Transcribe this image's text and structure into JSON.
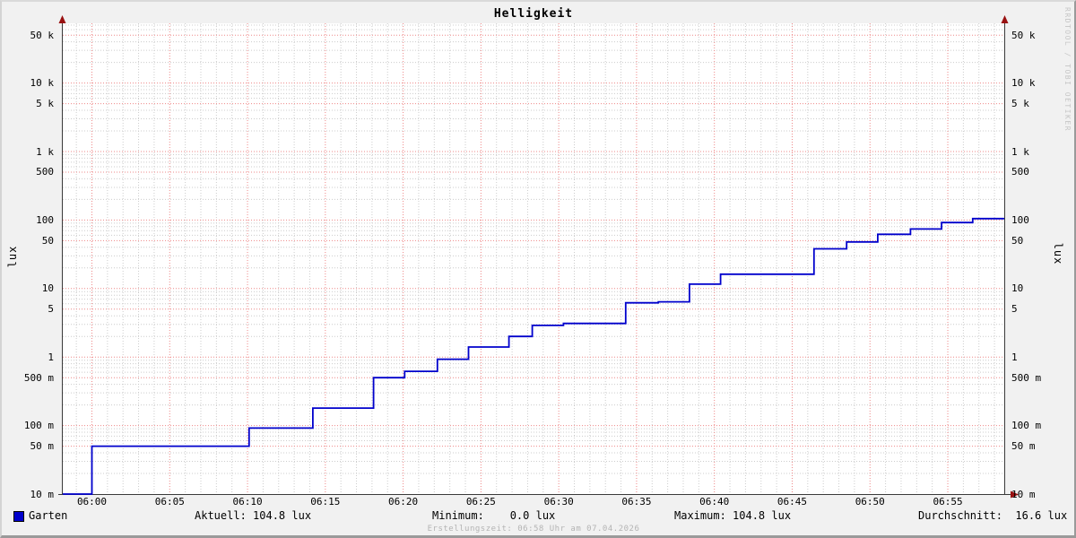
{
  "title": "Helligkeit",
  "watermark": "RRDTOOL / TOBI OETIKER",
  "y_axis_unit_left": "lux",
  "y_axis_unit_right": "lux",
  "footer": {
    "legend_label": "Garten",
    "aktuell": "Aktuell: 104.8 lux",
    "minimum": "Minimum:    0.0 lux",
    "maximum": "Maximum: 104.8 lux",
    "durchschnitt": "Durchschnitt:  16.6 lux",
    "erstellungszeit": "Erstellungszeit: 06:58 Uhr am 07.04.2026"
  },
  "colors": {
    "background": "#f1f1f1",
    "canvas": "#ffffff",
    "series_line": "#0000cc",
    "legend_swatch": "#0000cc",
    "major_grid": "#ee8888",
    "minor_grid": "#cccccc",
    "axis": "#3a3a3a",
    "arrow": "#991111",
    "watermark_text": "#c6c6c6",
    "creation_text": "#b4b4b4"
  },
  "chart_data": {
    "type": "line",
    "line_style": "step-after",
    "title": "Helligkeit",
    "xlabel": "",
    "ylabel": "lux",
    "y_scale": "log",
    "ylim": [
      0.01,
      75000
    ],
    "x_unit": "minutes after 06:00",
    "x_range_min": [
      -1.87,
      58.63
    ],
    "x_major_step_min": 5,
    "x_minor_step_min": 1,
    "x_ticks": [
      {
        "minute": 0,
        "label": "06:00"
      },
      {
        "minute": 5,
        "label": "06:05"
      },
      {
        "minute": 10,
        "label": "06:10"
      },
      {
        "minute": 15,
        "label": "06:15"
      },
      {
        "minute": 20,
        "label": "06:20"
      },
      {
        "minute": 25,
        "label": "06:25"
      },
      {
        "minute": 30,
        "label": "06:30"
      },
      {
        "minute": 35,
        "label": "06:35"
      },
      {
        "minute": 40,
        "label": "06:40"
      },
      {
        "minute": 45,
        "label": "06:45"
      },
      {
        "minute": 50,
        "label": "06:50"
      },
      {
        "minute": 55,
        "label": "06:55"
      }
    ],
    "y_ticks": [
      {
        "value": 50000,
        "label": "50 k"
      },
      {
        "value": 10000,
        "label": "10 k"
      },
      {
        "value": 5000,
        "label": "5 k"
      },
      {
        "value": 1000,
        "label": "1 k"
      },
      {
        "value": 500,
        "label": "500"
      },
      {
        "value": 100,
        "label": "100"
      },
      {
        "value": 50,
        "label": "50"
      },
      {
        "value": 10,
        "label": "10"
      },
      {
        "value": 5,
        "label": "5"
      },
      {
        "value": 1,
        "label": "1"
      },
      {
        "value": 0.5,
        "label": "500 m"
      },
      {
        "value": 0.1,
        "label": "100 m"
      },
      {
        "value": 0.05,
        "label": "50 m"
      },
      {
        "value": 0.01,
        "label": "10 m"
      }
    ],
    "y_minor_multipliers": [
      2,
      3,
      4,
      6,
      7,
      8,
      9
    ],
    "grid": true,
    "legend_position": "bottom-left",
    "legend": [
      {
        "label": "Garten",
        "color": "#0000cc"
      }
    ],
    "series": [
      {
        "name": "Garten",
        "color": "#0000cc",
        "points_minute_lux": [
          [
            -1.87,
            0.01
          ],
          [
            0.0,
            0.05
          ],
          [
            10.1,
            0.092
          ],
          [
            14.2,
            0.18
          ],
          [
            18.1,
            0.5
          ],
          [
            20.1,
            0.62
          ],
          [
            22.2,
            0.93
          ],
          [
            24.2,
            1.4
          ],
          [
            26.8,
            2.0
          ],
          [
            28.3,
            2.9
          ],
          [
            30.3,
            3.1
          ],
          [
            34.3,
            6.2
          ],
          [
            36.4,
            6.4
          ],
          [
            38.4,
            11.6
          ],
          [
            40.4,
            16.2
          ],
          [
            46.4,
            38
          ],
          [
            48.5,
            48
          ],
          [
            50.5,
            62
          ],
          [
            52.6,
            74
          ],
          [
            54.6,
            92
          ],
          [
            56.6,
            104.8
          ],
          [
            58.63,
            104.8
          ]
        ]
      }
    ],
    "stats": {
      "aktuell_lux": 104.8,
      "minimum_lux": 0.0,
      "maximum_lux": 104.8,
      "durchschnitt_lux": 16.6
    }
  }
}
